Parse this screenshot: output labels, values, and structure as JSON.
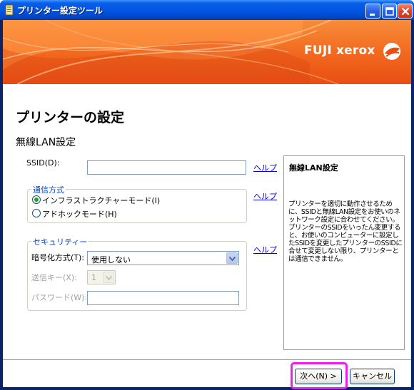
{
  "window": {
    "title": "プリンター設定ツール"
  },
  "banner": {
    "logo_text": "FUJI xerox",
    "colors": {
      "primary": "#f26a1f",
      "logo_accent": "#e94e14"
    }
  },
  "page": {
    "title": "プリンターの設定",
    "subtitle": "無線LAN設定"
  },
  "ssid": {
    "label": "SSID(D):",
    "value": "",
    "help_label": "ヘルプ"
  },
  "comm_mode": {
    "legend": "通信方式",
    "options": [
      {
        "label": "インフラストラクチャーモード(I)",
        "selected": true
      },
      {
        "label": "アドホックモード(H)",
        "selected": false
      }
    ],
    "help_label": "ヘルプ"
  },
  "security": {
    "legend": "セキュリティー",
    "help_label": "ヘルプ",
    "encryption": {
      "label": "暗号化方式(T):",
      "value": "使用しない"
    },
    "tx_key": {
      "label": "送信キー(X):",
      "value": "1"
    },
    "password": {
      "label": "パスワード(W):",
      "value": ""
    }
  },
  "info_panel": {
    "title": "無線LAN設定",
    "body": "プリンターを適切に動作させるために、SSIDと無線LAN設定をお使いのネットワーク設定に合わせてください。プリンターのSSIDをいったん変更すると、お使いのコンピューターに設定したSSIDを変更したプリンターのSSIDに合せて変更しない限り、プリンターとは通信できません。"
  },
  "footer": {
    "next_label": "次へ(N) >",
    "cancel_label": "キャンセル",
    "highlight_color": "#f01cf0"
  },
  "icons": {
    "app": "printer-tool-icon",
    "minimize": "minimize-icon",
    "maximize": "maximize-icon",
    "close": "close-icon",
    "dropdown": "chevron-down-icon",
    "logo": "xerox-sphere-icon"
  }
}
